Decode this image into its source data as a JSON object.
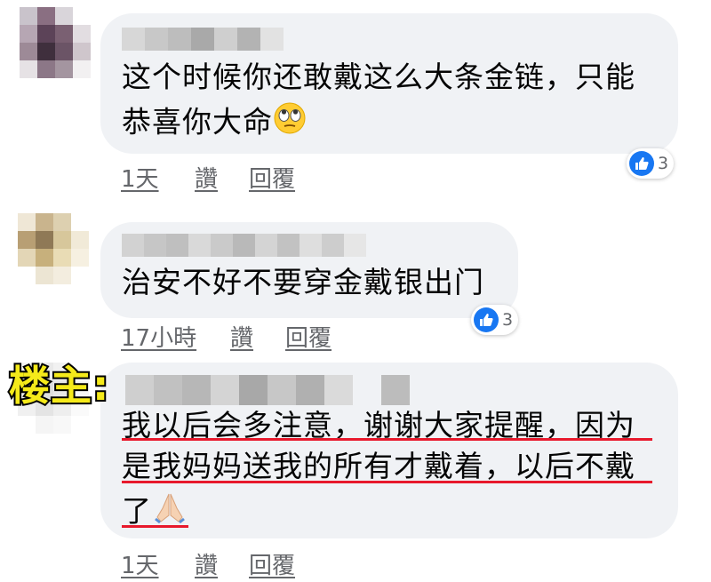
{
  "comments": [
    {
      "text_lines": [
        "这个时候你还敢戴这么大条金链，只能",
        "恭喜你大命"
      ],
      "emoji": "rolling-eyes-emoji",
      "actions": {
        "time": "1天",
        "like": "讚",
        "reply": "回覆"
      },
      "reaction": {
        "icon": "like-icon",
        "count": "3"
      }
    },
    {
      "text_lines": [
        "治安不好不要穿金戴银出门"
      ],
      "actions": {
        "time": "17小時",
        "like": "讚",
        "reply": "回覆"
      },
      "reaction": {
        "icon": "like-icon",
        "count": "3"
      }
    },
    {
      "owner_label": "楼主:",
      "text_lines": [
        "我以后会多注意，谢谢大家提醒，因为",
        "是我妈妈送我的所有才戴着，以后不戴",
        "了"
      ],
      "emoji": "folded-hands-emoji",
      "actions": {
        "time": "1天",
        "like": "讚",
        "reply": "回覆"
      }
    }
  ],
  "colors": {
    "bubble": "#f0f2f5",
    "action_text": "#65676b",
    "like_blue": "#1877f2",
    "underline_red": "#e8192c",
    "owner_label_fill": "#f5ea1a"
  }
}
